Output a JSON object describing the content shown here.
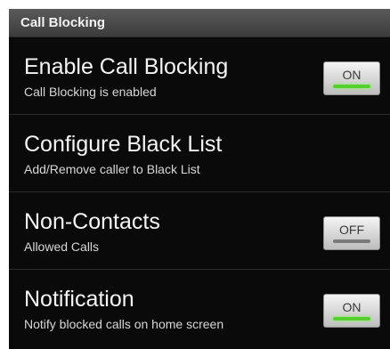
{
  "header": {
    "title": "Call Blocking"
  },
  "settings": [
    {
      "title": "Enable Call Blocking",
      "summary": "Call Blocking is enabled",
      "toggle": "ON"
    },
    {
      "title": "Configure Black List",
      "summary": "Add/Remove caller to Black List"
    },
    {
      "title": "Non-Contacts",
      "summary": "Allowed Calls",
      "toggle": "OFF"
    },
    {
      "title": "Notification",
      "summary": "Notify blocked calls on home screen",
      "toggle": "ON"
    }
  ],
  "colors": {
    "background": "#0a0a0a",
    "header_bg": "#4a4a4a",
    "toggle_on_indicator": "#55d02f",
    "toggle_off_indicator": "#7a7a7a"
  }
}
